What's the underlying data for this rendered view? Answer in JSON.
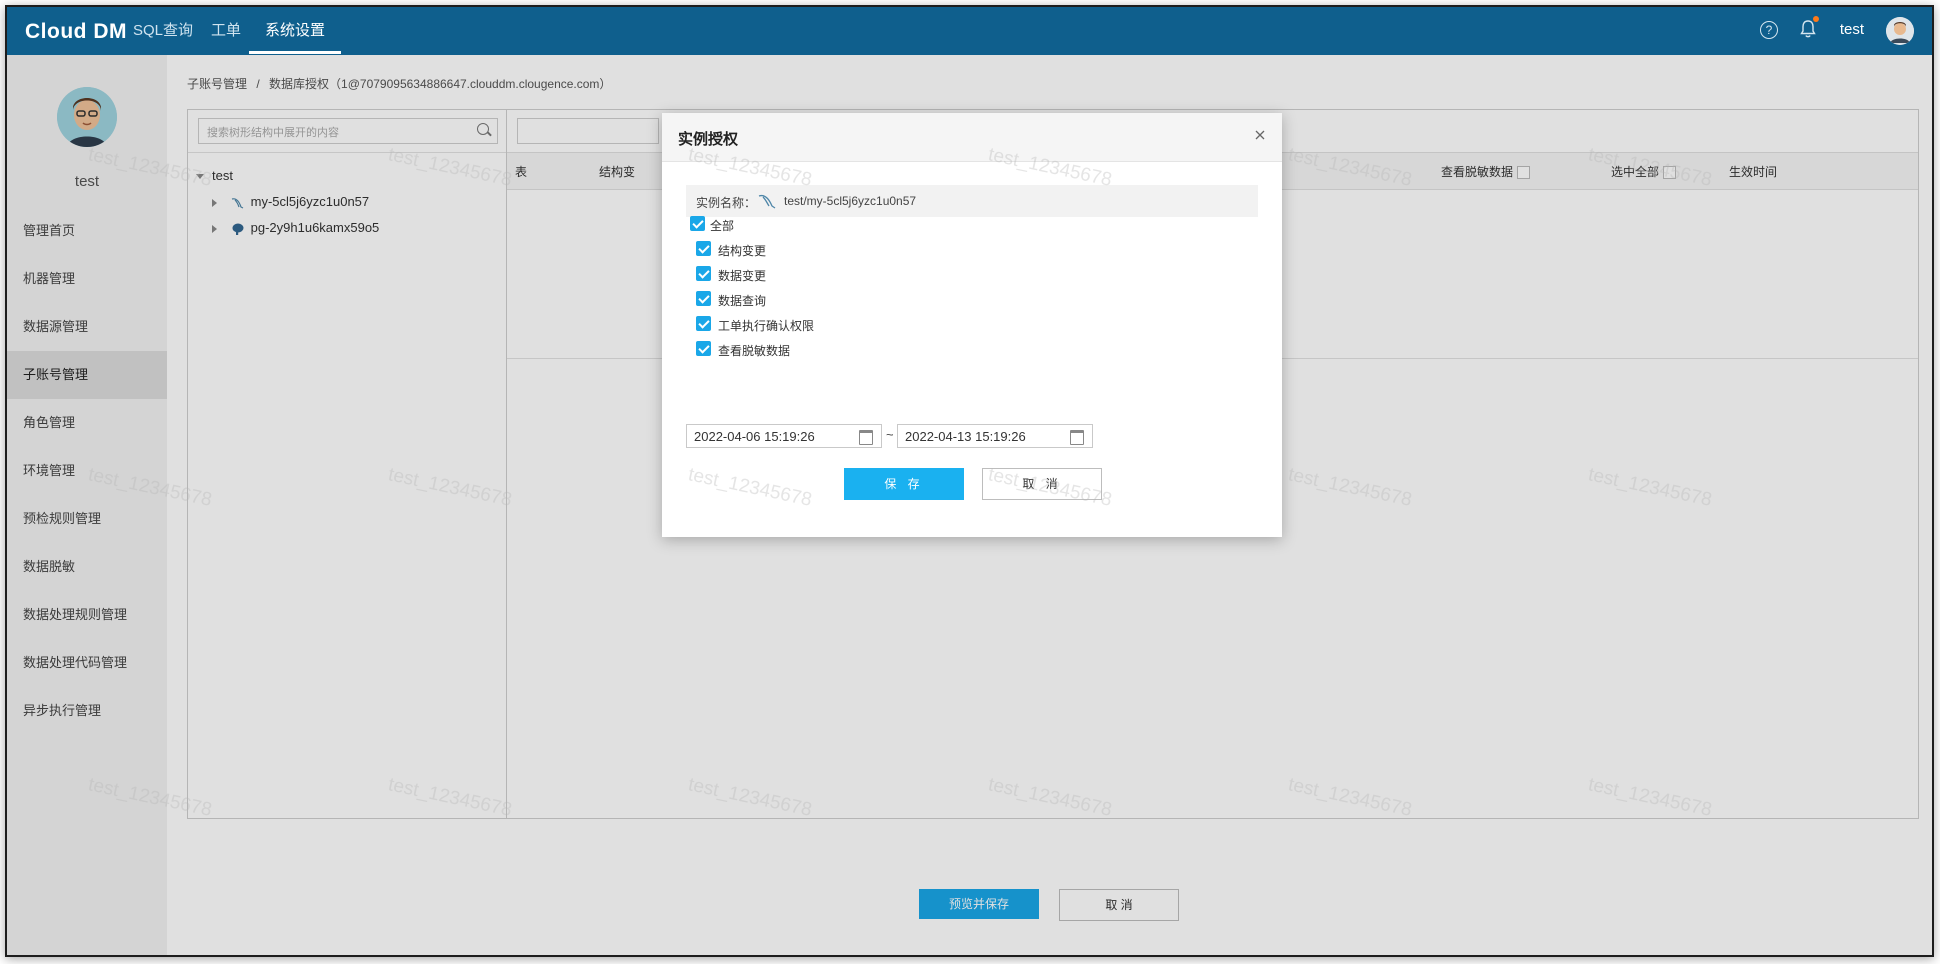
{
  "app": {
    "logo": "Cloud DM",
    "nav_tabs": [
      {
        "label": "SQL查询"
      },
      {
        "label": "工单"
      },
      {
        "label": "系统设置"
      }
    ],
    "help_symbol": "?",
    "user": "test"
  },
  "sidebar": {
    "user": "test",
    "items": [
      {
        "label": "管理首页"
      },
      {
        "label": "机器管理"
      },
      {
        "label": "数据源管理"
      },
      {
        "label": "子账号管理"
      },
      {
        "label": "角色管理"
      },
      {
        "label": "环境管理"
      },
      {
        "label": "预检规则管理"
      },
      {
        "label": "数据脱敏"
      },
      {
        "label": "数据处理规则管理"
      },
      {
        "label": "数据处理代码管理"
      },
      {
        "label": "异步执行管理"
      }
    ]
  },
  "breadcrumb": {
    "parent": "子账号管理",
    "separator": "/",
    "current": "数据库授权（1@7079095634886647.clouddm.clougence.com）"
  },
  "tree": {
    "search_placeholder": "搜索树形结构中展开的内容",
    "root": "test",
    "children": [
      {
        "label": "my-5cl5j6yzc1u0n57",
        "icon": "mysql-icon"
      },
      {
        "label": "pg-2y9h1u6kamx59o5",
        "icon": "postgresql-icon"
      }
    ]
  },
  "grid": {
    "headers": {
      "table": "表",
      "struct": "结构变",
      "view_masked": "查看脱敏数据",
      "select_all": "选中全部",
      "effective_time": "生效时间"
    }
  },
  "footer": {
    "preview_save": "预览并保存",
    "cancel": "取 消"
  },
  "modal": {
    "title": "实例授权",
    "instance_label": "实例名称：",
    "instance_value": "test/my-5cl5j6yzc1u0n57",
    "permissions": [
      {
        "label": "全部",
        "checked": true
      },
      {
        "label": "结构变更",
        "checked": true
      },
      {
        "label": "数据变更",
        "checked": true
      },
      {
        "label": "数据查询",
        "checked": true
      },
      {
        "label": "工单执行确认权限",
        "checked": true
      },
      {
        "label": "查看脱敏数据",
        "checked": true
      }
    ],
    "start_date": "2022-04-06 15:19:26",
    "date_separator": "~",
    "end_date": "2022-04-13 15:19:26",
    "save": "保 存",
    "cancel": "取 消"
  },
  "watermark": "test_12345678",
  "colors": {
    "topbar": "#0f5f8d",
    "primary_button": "#1ab1f0",
    "checkbox": "#1aa7e8"
  }
}
